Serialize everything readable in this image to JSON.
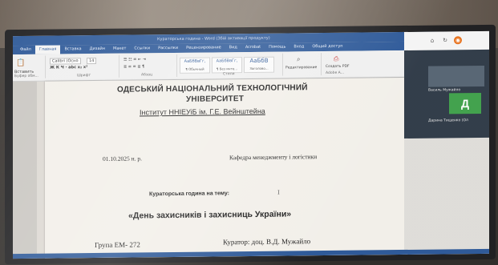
{
  "window": {
    "doc_title": "Кураторська година - Word (Збій активації продукту)"
  },
  "menu_tabs": [
    "Файл",
    "Главная",
    "Вставка",
    "Дизайн",
    "Макет",
    "Ссылки",
    "Рассылки",
    "Рецензирование",
    "Вид",
    "Acrobat",
    "Помощь",
    "Вход",
    "Общий доступ"
  ],
  "ribbon": {
    "paste_label": "Вставить",
    "font_name": "Calibri (Осно",
    "font_size": "14",
    "clipboard_label": "Буфер обм...",
    "font_label": "Шрифт",
    "paragraph_label": "Абзац",
    "styles_label": "Стили",
    "style1": "АаБбВвГг,",
    "style1_name": "¶ Обычный",
    "style2": "АаБбВвГг,",
    "style2_name": "¶ Без инте...",
    "style3": "АаБбВ",
    "style3_name": "Заголово...",
    "editing_label": "Редактирование",
    "pdf_label": "Создать PDF",
    "adobe_label": "Adobe A..."
  },
  "document": {
    "university": "ОДЕСЬКИЙ НАЦІОНАЛЬНИЙ ТЕХНОЛОГІЧНИЙ",
    "university2": "УНІВЕРСИТЕТ",
    "institute": "Інститут ННІЕУіБ ім. Г.Е. Вейнштейна",
    "date": "01.10.2025 н. р.",
    "department": "Кафедра менеджменту і логістики",
    "curator_hour": "Кураторська година на тему:",
    "topic": "«День захисників і захисниць України»",
    "group": "Група ЕМ- 272",
    "curator": "Куратор: доц. В.Д. Мужайло"
  },
  "call": {
    "participant1": "Василь Мужайло",
    "participant2": "Дарина Тищенко (Ол",
    "avatar_letter": "Д"
  },
  "colors": {
    "word_blue": "#2b5797",
    "avatar_green": "#3fa04a"
  }
}
